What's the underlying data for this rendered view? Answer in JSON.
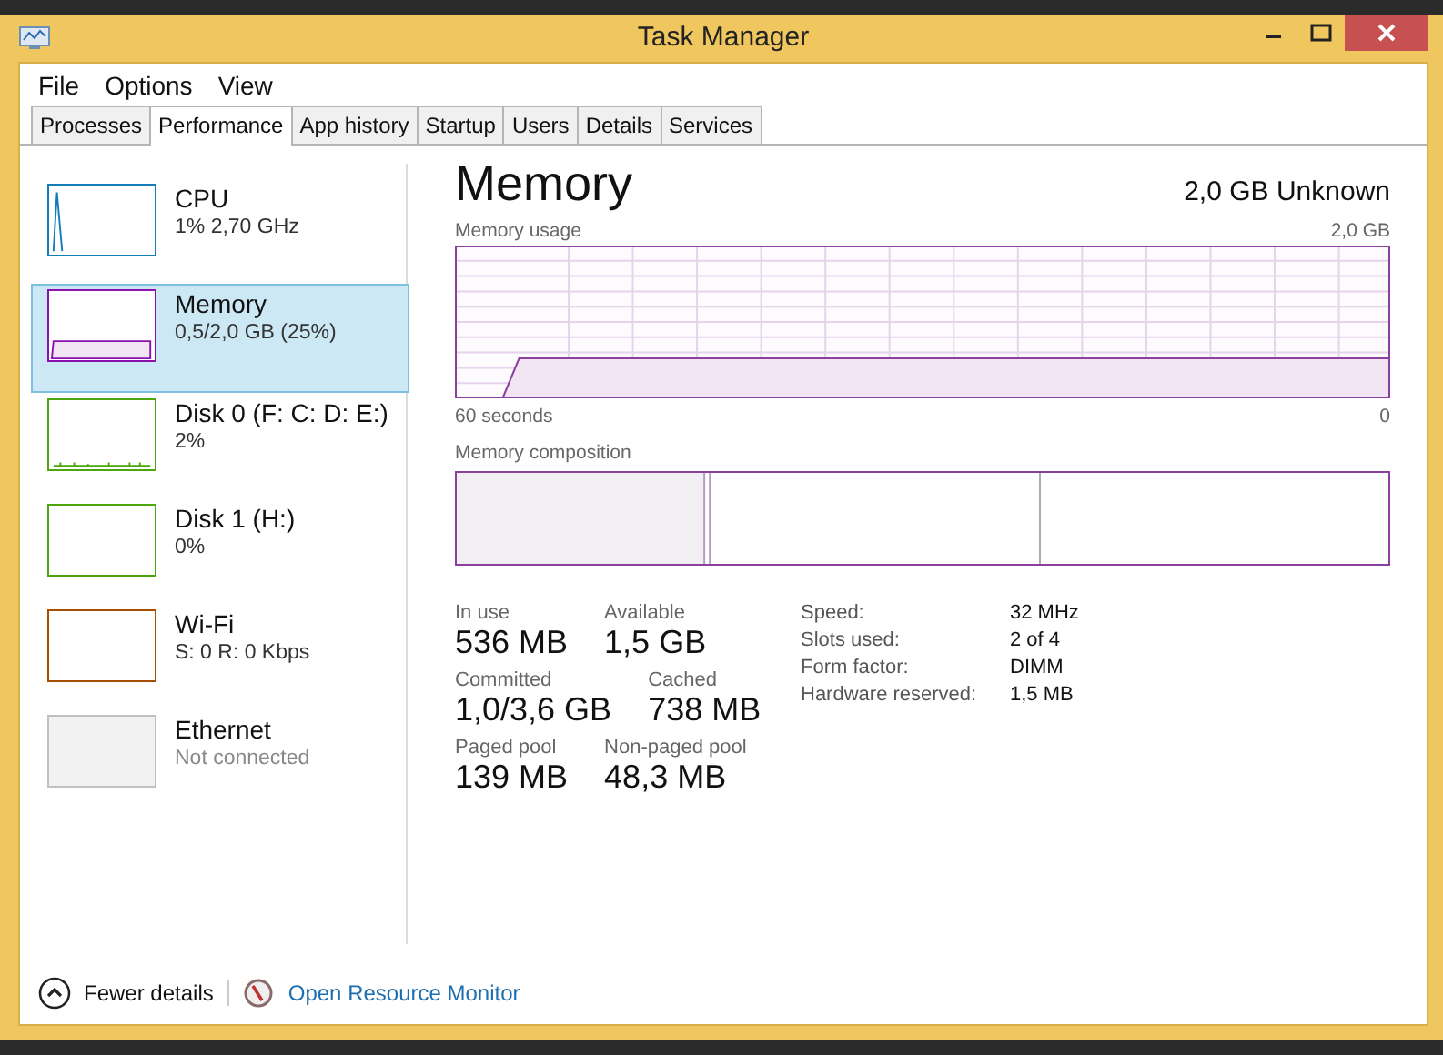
{
  "window": {
    "title": "Task Manager"
  },
  "menu": [
    "File",
    "Options",
    "View"
  ],
  "tabs": [
    {
      "label": "Processes",
      "selected": false
    },
    {
      "label": "Performance",
      "selected": true
    },
    {
      "label": "App history",
      "selected": false
    },
    {
      "label": "Startup",
      "selected": false
    },
    {
      "label": "Users",
      "selected": false
    },
    {
      "label": "Details",
      "selected": false
    },
    {
      "label": "Services",
      "selected": false
    }
  ],
  "sidebar": {
    "items": [
      {
        "name": "CPU",
        "detail": "1% 2,70 GHz",
        "kind": "spike",
        "color": "#117dbb",
        "selected": false,
        "disabled": false
      },
      {
        "name": "Memory",
        "detail": "0,5/2,0 GB (25%)",
        "kind": "fill",
        "color": "#8b12ae",
        "selected": true,
        "disabled": false
      },
      {
        "name": "Disk 0 (F: C: D: E:)",
        "detail": "2%",
        "kind": "ticks",
        "color": "#4da60c",
        "selected": false,
        "disabled": false
      },
      {
        "name": "Disk 1 (H:)",
        "detail": "0%",
        "kind": "flat",
        "color": "#4da60c",
        "selected": false,
        "disabled": false
      },
      {
        "name": "Wi-Fi",
        "detail": "S: 0 R: 0 Kbps",
        "kind": "flat",
        "color": "#a74f01",
        "selected": false,
        "disabled": false
      },
      {
        "name": "Ethernet",
        "detail": "Not connected",
        "kind": "flat",
        "color": "#c0c0c0",
        "selected": false,
        "disabled": true
      }
    ]
  },
  "main": {
    "title": "Memory",
    "summary": "2,0 GB Unknown",
    "usage_graph": {
      "label": "Memory usage",
      "max": "2,0 GB",
      "start": "60 seconds",
      "end": "0"
    },
    "composition": {
      "label": "Memory composition"
    },
    "stats": [
      [
        {
          "label": "In use",
          "value": "536 MB"
        },
        {
          "label": "Available",
          "value": "1,5 GB"
        }
      ],
      [
        {
          "label": "Committed",
          "value": "1,0/3,6 GB"
        },
        {
          "label": "Cached",
          "value": "738 MB"
        }
      ],
      [
        {
          "label": "Paged pool",
          "value": "139 MB"
        },
        {
          "label": "Non-paged pool",
          "value": "48,3 MB"
        }
      ]
    ],
    "properties": [
      {
        "label": "Speed:",
        "value": "32 MHz"
      },
      {
        "label": "Slots used:",
        "value": "2 of 4"
      },
      {
        "label": "Form factor:",
        "value": "DIMM"
      },
      {
        "label": "Hardware reserved:",
        "value": "1,5 MB"
      }
    ]
  },
  "footer": {
    "fewer": "Fewer details",
    "link": "Open Resource Monitor"
  }
}
